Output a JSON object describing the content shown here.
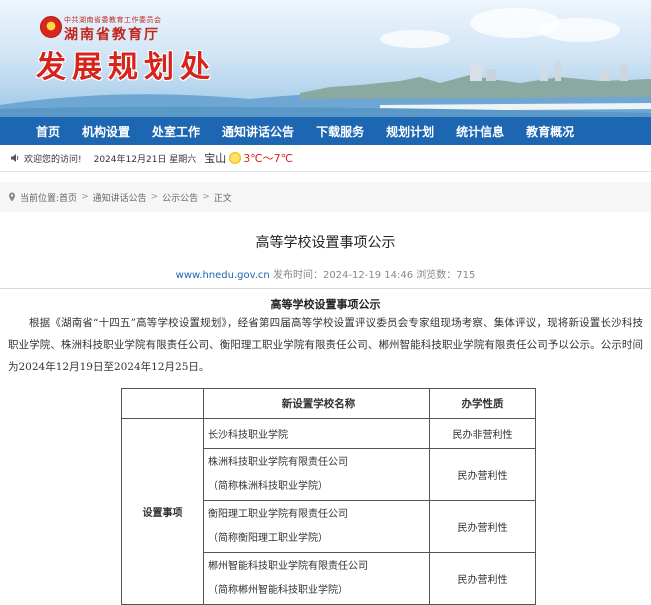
{
  "header": {
    "org_small": "中共湖南省委教育工作委员会",
    "org_name": "湖南省教育厅",
    "dept_name": "发展规划处"
  },
  "nav": {
    "items": [
      "首页",
      "机构设置",
      "处室工作",
      "通知讲话公告",
      "下载服务",
      "规划计划",
      "统计信息",
      "教育概况"
    ]
  },
  "info": {
    "welcome": "欢迎您的访问!",
    "date": "2024年12月21日 星期六",
    "city": "宝山",
    "temp": "3℃～7℃"
  },
  "breadcrumb": {
    "label": "当前位置:",
    "items": [
      "首页",
      "通知讲话公告",
      "公示公告",
      "正文"
    ]
  },
  "article": {
    "title": "高等学校设置事项公示",
    "site": "www.hnedu.gov.cn",
    "publish_time": "发布时间：2024-12-19 14:46",
    "views": "浏览数：715",
    "sub_title": "高等学校设置事项公示",
    "paragraph": "根据《湖南省“十四五”高等学校设置规划》，经省第四届高等学校设置评议委员会专家组现场考察、集体评议，现将新设置长沙科技职业学院、株洲科技职业学院有限责任公司、衡阳理工职业学院有限责任公司、郴州智能科技职业学院有限责任公司予以公示。公示时间为2024年12月19日至2024年12月25日。"
  },
  "table": {
    "headers": [
      "新设置学校名称",
      "办学性质"
    ],
    "row_label": "设置事项",
    "rows": [
      {
        "name": "长沙科技职业学院",
        "alias": "",
        "nature": "民办非营利性"
      },
      {
        "name": "株洲科技职业学院有限责任公司",
        "alias": "（简称株洲科技职业学院）",
        "nature": "民办营利性"
      },
      {
        "name": "衡阳理工职业学院有限责任公司",
        "alias": "（简称衡阳理工职业学院）",
        "nature": "民办营利性"
      },
      {
        "name": "郴州智能科技职业学院有限责任公司",
        "alias": "（简称郴州智能科技职业学院）",
        "nature": "民办营利性"
      }
    ]
  },
  "colors": {
    "nav_bg": "#1d66b2",
    "brand_red": "#d6241c"
  },
  "icons": {
    "speaker": "speaker-icon",
    "weather": "sun-icon",
    "location": "pin-icon"
  }
}
